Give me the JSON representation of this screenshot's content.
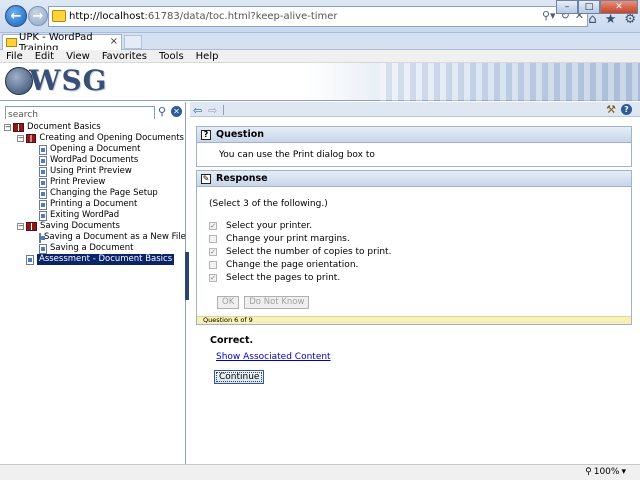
{
  "browser": {
    "url_host": "http://localhost",
    "url_rest": ":61783/data/toc.html?keep-alive-timer",
    "tab_title": "UPK - WordPad Training",
    "tab_close": "×",
    "menu": [
      "File",
      "Edit",
      "View",
      "Favorites",
      "Tools",
      "Help"
    ],
    "zoom": "100%"
  },
  "banner": {
    "logo_text": "WSG"
  },
  "search": {
    "placeholder": "search",
    "value": "search"
  },
  "toc": [
    {
      "label": "Document Basics",
      "level": 0,
      "type": "book",
      "expanded": true
    },
    {
      "label": "Creating and Opening Documents",
      "level": 1,
      "type": "book",
      "expanded": true
    },
    {
      "label": "Opening a Document",
      "level": 2,
      "type": "page"
    },
    {
      "label": "WordPad Documents",
      "level": 2,
      "type": "question"
    },
    {
      "label": "Using Print Preview",
      "level": 2,
      "type": "page"
    },
    {
      "label": "Print Preview",
      "level": 2,
      "type": "question"
    },
    {
      "label": "Changing the Page Setup",
      "level": 2,
      "type": "page"
    },
    {
      "label": "Printing a Document",
      "level": 2,
      "type": "page"
    },
    {
      "label": "Exiting WordPad",
      "level": 2,
      "type": "page"
    },
    {
      "label": "Saving Documents",
      "level": 1,
      "type": "book",
      "expanded": true
    },
    {
      "label": "Saving a Document as a New File",
      "level": 2,
      "type": "page"
    },
    {
      "label": "Saving a Document",
      "level": 2,
      "type": "question"
    },
    {
      "label": "Assessment - Document Basics",
      "level": 1,
      "type": "page",
      "selected": true
    }
  ],
  "question": {
    "header": "Question",
    "text": "You can use the Print dialog box to"
  },
  "response": {
    "header": "Response",
    "instruction": "(Select 3 of the following.)",
    "options": [
      {
        "label": "Select your printer.",
        "checked": true
      },
      {
        "label": "Change your print margins.",
        "checked": false
      },
      {
        "label": "Select the number of copies to print.",
        "checked": true
      },
      {
        "label": "Change the page orientation.",
        "checked": false
      },
      {
        "label": "Select the pages to print.",
        "checked": true
      }
    ],
    "ok_label": "OK",
    "dont_know_label": "Do Not Know",
    "progress": "Question 6 of 9"
  },
  "feedback": {
    "result": "Correct.",
    "link": "Show Associated Content",
    "continue_label": "Continue"
  }
}
